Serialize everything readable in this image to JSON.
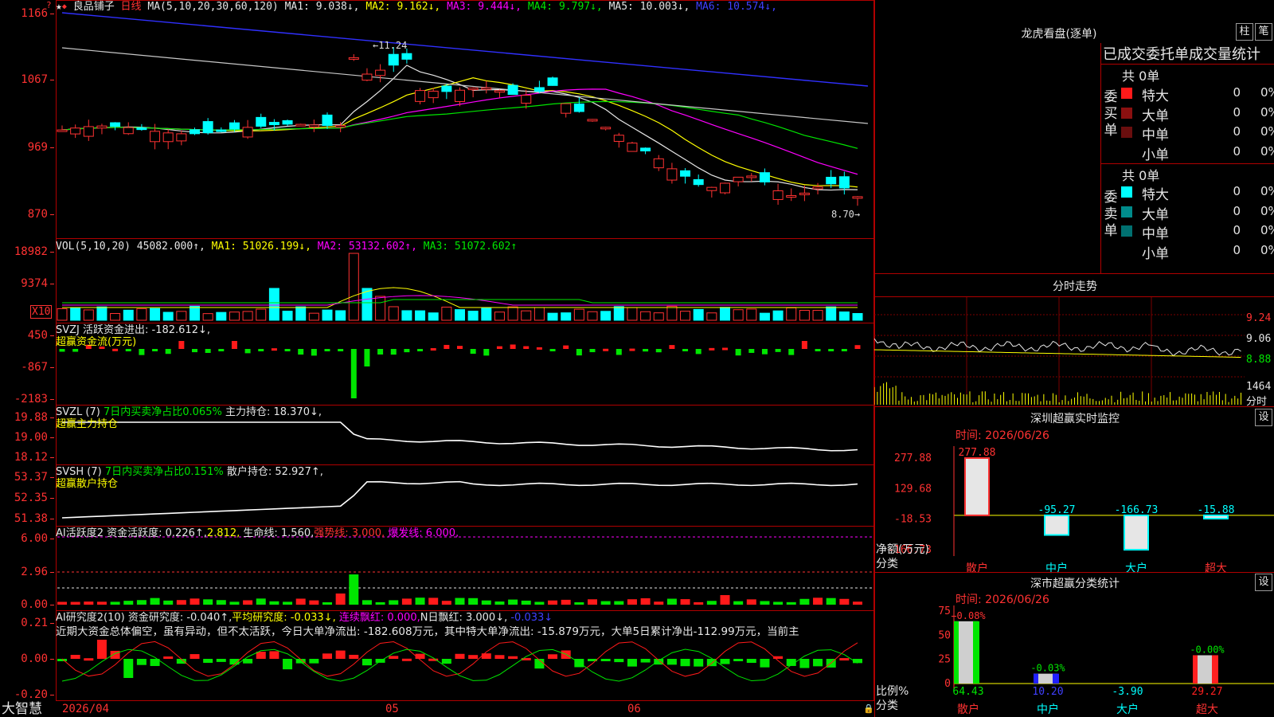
{
  "main": {
    "stock_name": "良品铺子",
    "period": "日线",
    "ma_header": "MA(5,10,20,30,60,120)",
    "ma": [
      {
        "label": "MA1:",
        "value": "9.038",
        "arrow": "↓",
        "color": "#e6e6e6"
      },
      {
        "label": "MA2:",
        "value": "9.162",
        "arrow": "↓",
        "color": "#ffff00"
      },
      {
        "label": "MA3:",
        "value": "9.444",
        "arrow": "↓",
        "color": "#ff00ff"
      },
      {
        "label": "MA4:",
        "value": "9.797",
        "arrow": "↓",
        "color": "#00e600"
      },
      {
        "label": "MA5:",
        "value": "10.003",
        "arrow": "↓",
        "color": "#e6e6e6"
      },
      {
        "label": "MA6:",
        "value": "10.574",
        "arrow": "↓",
        "color": "#4040ff"
      }
    ],
    "price_axis": [
      "1166",
      "1067",
      "969",
      "870"
    ],
    "high_label": "11.24",
    "low_label": "8.70"
  },
  "vol": {
    "header": "VOL(5,10,20)",
    "value": "45082.000↑,",
    "ma1": "MA1: 51026.199↓,",
    "ma2": "MA2: 53132.602↑,",
    "ma3": "MA3: 51072.602↑",
    "axis": [
      "18982",
      "9374"
    ],
    "unit": "X10"
  },
  "svzj": {
    "header": "SVZJ  活跃资金进出: -182.612↓,",
    "sub": "超赢资金流(万元)",
    "axis": [
      "450",
      "-867",
      "-2183"
    ]
  },
  "svzl": {
    "header_a": "SVZL (7) ",
    "header_b": "7日内买卖净占比0.065%",
    "header_c": " 主力持仓: 18.370↓,",
    "sub": "超赢主力持仓",
    "axis": [
      "19.88",
      "19.00",
      "18.12"
    ]
  },
  "svsh": {
    "header_a": "SVSH (7) ",
    "header_b": "7日内买卖净占比0.151%",
    "header_c": " 散户持仓: 52.927↑,",
    "sub": "超赢散户持仓",
    "axis": [
      "53.37",
      "52.35",
      "51.38"
    ]
  },
  "ai2": {
    "h1": "AI活跃度2 资金活跃度: 0.226↑,",
    "h2": "2.812,",
    "h3": "生命线: 1.560,",
    "h4": "强势线: 3.000,",
    "h5": "爆发线: 6.000,",
    "axis": [
      "6.00",
      "2.96",
      "0.00"
    ]
  },
  "air": {
    "h1": "AI研究度2(10) 资金研究度: -0.040↑,",
    "h2": "平均研究度: -0.033↓,",
    "h3": "连续飘红: 0.000,",
    "h4": "N日飘红: 3.000↓,",
    "h5": "-0.033↓",
    "note": "近期大资金总体偏空，虽有异动，但不太活跃，今日大单净流出: -182.608万元，其中特大单净流出: -15.879万元，大单5日累计净出-112.99万元，当前主",
    "axis": [
      "0.21",
      "0.00",
      "-0.20"
    ]
  },
  "bottom": {
    "brand": "大智慧",
    "date_start": "2026/04",
    "month_05": "05",
    "month_06": "06"
  },
  "right": {
    "dragon_title": "龙虎看盘(逐单)",
    "btn_zhu": "柱",
    "btn_bi": "笔",
    "tabs_label": "已成交委托单成交量统计",
    "buy_label": "委买单",
    "sell_label": "委卖单",
    "buy_total": "共 0单",
    "sell_total": "共 0单",
    "buy_rows": [
      {
        "name": "特大",
        "v": "0",
        "p": "0%",
        "color": "#ff1a1a"
      },
      {
        "name": "大单",
        "v": "0",
        "p": "0%",
        "color": "#8b1010"
      },
      {
        "name": "中单",
        "v": "0",
        "p": "0%",
        "color": "#6a0e0e"
      },
      {
        "name": "小单",
        "v": "0",
        "p": "0%",
        "color": ""
      }
    ],
    "sell_rows": [
      {
        "name": "特大",
        "v": "0",
        "p": "0%",
        "color": "#00ffff"
      },
      {
        "name": "大单",
        "v": "0",
        "p": "0%",
        "color": "#008b8b"
      },
      {
        "name": "中单",
        "v": "0",
        "p": "0%",
        "color": "#007070"
      },
      {
        "name": "小单",
        "v": "0",
        "p": "0%",
        "color": ""
      }
    ],
    "fenshi_title": "分时走势",
    "fenshi_axis": [
      "9.24",
      "9.06",
      "8.88",
      "1464"
    ],
    "fenshi_unit": "分时",
    "sz_title": "深圳超赢实时监控",
    "sz_btn": "设",
    "sz_date": "时间: 2026/06/26",
    "sz_axis": [
      "277.88",
      "129.68",
      "-18.53",
      "-166.73"
    ],
    "sz_ylabel": "净额(万元)",
    "sz_xlabel": "分类",
    "sz_values": [
      {
        "cat": "散户",
        "value": 277.88,
        "label": "277.88"
      },
      {
        "cat": "中户",
        "value": -95.27,
        "label": "-95.27"
      },
      {
        "cat": "大户",
        "value": -166.73,
        "label": "-166.73"
      },
      {
        "cat": "超大",
        "value": -15.88,
        "label": "-15.88"
      }
    ],
    "ss_title": "深市超赢分类统计",
    "ss_btn": "设",
    "ss_date": "时间: 2026/06/26",
    "ss_axis": [
      "75",
      "50",
      "25",
      "0"
    ],
    "ss_ylabel": "比例%",
    "ss_xlabel": "分类",
    "ss_values": [
      {
        "cat": "散户",
        "value": 64.43,
        "label": "64.43",
        "top": "+0.08%",
        "color": "#00e600"
      },
      {
        "cat": "中户",
        "value": 10.2,
        "label": "10.20",
        "top": "-0.03%",
        "color": "#2020ff"
      },
      {
        "cat": "大户",
        "value": -3.9,
        "label": "-3.90",
        "top": "",
        "color": "#00ffff"
      },
      {
        "cat": "超大",
        "value": 29.27,
        "label": "29.27",
        "top": "-0.00%",
        "color": "#ff2020"
      }
    ]
  }
}
